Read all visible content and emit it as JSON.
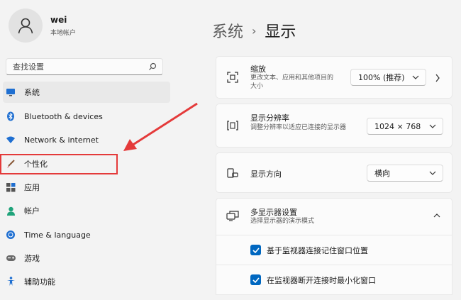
{
  "user": {
    "name": "wei",
    "type": "本地帐户"
  },
  "search": {
    "placeholder": "查找设置"
  },
  "sidebar": {
    "items": [
      {
        "label": "系统",
        "icon": "monitor-icon"
      },
      {
        "label": "Bluetooth & devices",
        "icon": "bluetooth-icon"
      },
      {
        "label": "Network & internet",
        "icon": "wifi-icon"
      },
      {
        "label": "个性化",
        "icon": "brush-icon"
      },
      {
        "label": "应用",
        "icon": "apps-icon"
      },
      {
        "label": "帐户",
        "icon": "account-icon"
      },
      {
        "label": "Time & language",
        "icon": "globe-clock-icon"
      },
      {
        "label": "游戏",
        "icon": "gamepad-icon"
      },
      {
        "label": "辅助功能",
        "icon": "accessibility-icon"
      }
    ]
  },
  "breadcrumb": {
    "parent": "系统",
    "current": "显示"
  },
  "settings": {
    "scale": {
      "title": "缩放",
      "desc": "更改文本、应用和其他项目的大小",
      "value": "100% (推荐)"
    },
    "resolution": {
      "title": "显示分辨率",
      "desc": "调整分辨率以适应已连接的显示器",
      "value": "1024 × 768"
    },
    "orientation": {
      "title": "显示方向",
      "value": "横向"
    },
    "multi_display": {
      "title": "多显示器设置",
      "desc": "选择显示器的演示模式",
      "options": [
        {
          "label": "基于监视器连接记住窗口位置",
          "checked": true
        },
        {
          "label": "在监视器断开连接时最小化窗口",
          "checked": true
        }
      ]
    }
  },
  "colors": {
    "accent": "#0067c0",
    "annotation": "#e43a3a"
  }
}
